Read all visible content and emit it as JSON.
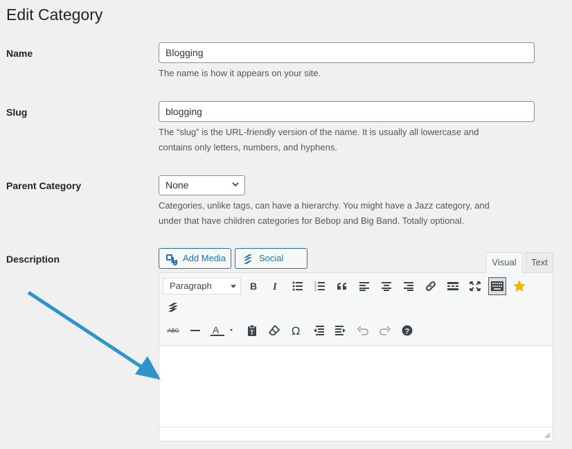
{
  "page": {
    "title": "Edit Category"
  },
  "name_field": {
    "label": "Name",
    "value": "Blogging",
    "help": "The name is how it appears on your site."
  },
  "slug_field": {
    "label": "Slug",
    "value": "blogging",
    "help_line1": "The “slug” is the URL-friendly version of the name. It is usually all lowercase and",
    "help_line2": "contains only letters, numbers, and hyphens."
  },
  "parent_field": {
    "label": "Parent Category",
    "selected": "None",
    "help_line1": "Categories, unlike tags, can have a hierarchy. You might have a Jazz category, and",
    "help_line2": "under that have children categories for Bebop and Big Band. Totally optional."
  },
  "description_field": {
    "label": "Description",
    "add_media_label": "Add Media",
    "social_snap_label": "Social Snap",
    "tabs": [
      {
        "label": "Visual",
        "active": true
      },
      {
        "label": "Text",
        "active": false
      }
    ],
    "format_select": "Paragraph",
    "toolbar_row1": [
      "bold-icon",
      "italic-icon",
      "bullet-list-icon",
      "numbered-list-icon",
      "blockquote-icon",
      "align-left-icon",
      "align-center-icon",
      "align-right-icon",
      "link-icon",
      "read-more-icon",
      "fullscreen-icon",
      "toolbar-toggle-icon",
      "star-icon",
      "social-snap-icon"
    ],
    "toolbar_row2": [
      "strikethrough-icon",
      "horizontal-line-icon",
      "text-color-icon",
      "paste-text-icon",
      "clear-formatting-icon",
      "special-character-icon",
      "outdent-icon",
      "indent-icon",
      "undo-icon",
      "redo-icon",
      "help-icon"
    ],
    "content": ""
  },
  "colors": {
    "accent": "#2271b1",
    "annotation_arrow": "#2e95c9",
    "star": "#f0b400"
  }
}
